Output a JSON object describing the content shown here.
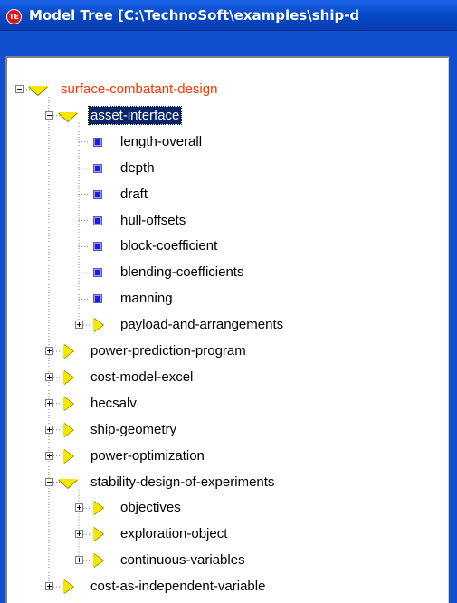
{
  "window": {
    "title": "Model Tree [C:\\TechnoSoft\\examples\\ship-d",
    "app_icon_text": "TE"
  },
  "tree": {
    "nodes": [
      {
        "label": "surface-combatant-design",
        "kind": "folder",
        "state": "expanded",
        "depth": 0,
        "root": true
      },
      {
        "label": "asset-interface",
        "kind": "folder",
        "state": "expanded",
        "depth": 1,
        "selected": true
      },
      {
        "label": "length-overall",
        "kind": "leaf",
        "depth": 2
      },
      {
        "label": "depth",
        "kind": "leaf",
        "depth": 2
      },
      {
        "label": "draft",
        "kind": "leaf",
        "depth": 2
      },
      {
        "label": "hull-offsets",
        "kind": "leaf",
        "depth": 2
      },
      {
        "label": "block-coefficient",
        "kind": "leaf",
        "depth": 2
      },
      {
        "label": "blending-coefficients",
        "kind": "leaf",
        "depth": 2
      },
      {
        "label": "manning",
        "kind": "leaf",
        "depth": 2
      },
      {
        "label": "payload-and-arrangements",
        "kind": "folder",
        "state": "collapsed",
        "depth": 2
      },
      {
        "label": "power-prediction-program",
        "kind": "folder",
        "state": "collapsed",
        "depth": 1
      },
      {
        "label": "cost-model-excel",
        "kind": "folder",
        "state": "collapsed",
        "depth": 1
      },
      {
        "label": "hecsalv",
        "kind": "folder",
        "state": "collapsed",
        "depth": 1
      },
      {
        "label": "ship-geometry",
        "kind": "folder",
        "state": "collapsed",
        "depth": 1
      },
      {
        "label": "power-optimization",
        "kind": "folder",
        "state": "collapsed",
        "depth": 1
      },
      {
        "label": "stability-design-of-experiments",
        "kind": "folder",
        "state": "expanded",
        "depth": 1
      },
      {
        "label": "objectives",
        "kind": "folder",
        "state": "collapsed",
        "depth": 2
      },
      {
        "label": "exploration-object",
        "kind": "folder",
        "state": "collapsed",
        "depth": 2
      },
      {
        "label": "continuous-variables",
        "kind": "folder",
        "state": "collapsed",
        "depth": 2
      },
      {
        "label": "cost-as-independent-variable",
        "kind": "folder",
        "state": "collapsed",
        "depth": 1
      }
    ]
  },
  "colors": {
    "titlebar": "#0447c4",
    "frame": "#0f4fd0",
    "root_label": "#ff3300",
    "folder_icon": "#f7e600",
    "leaf_icon": "#1d1ddc",
    "selection": "#0a246a"
  }
}
